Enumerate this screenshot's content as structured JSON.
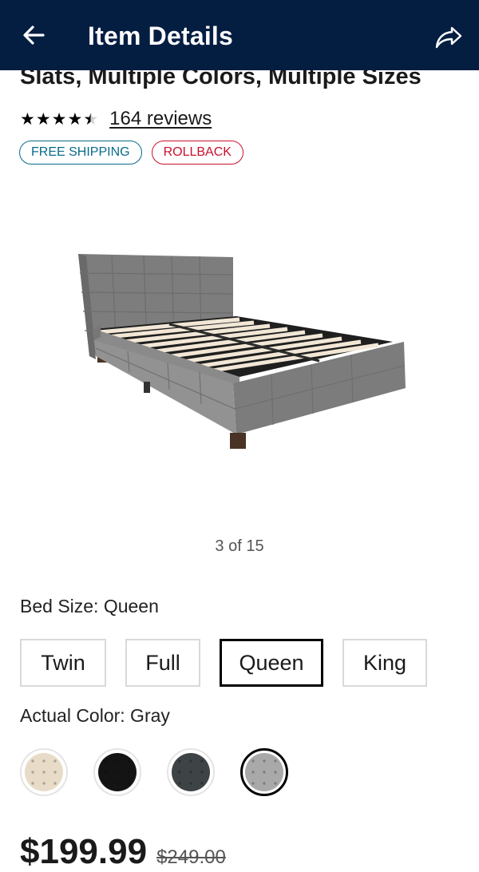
{
  "header": {
    "title": "Item Details",
    "back_icon": "arrow-left-icon",
    "share_icon": "share-icon"
  },
  "product": {
    "title_visible": "Slats, Multiple Colors, Multiple Sizes",
    "rating": 4.5,
    "reviews_text": "164 reviews",
    "badges": [
      "FREE SHIPPING",
      "ROLLBACK"
    ]
  },
  "gallery": {
    "pager_text": "3 of 15"
  },
  "options": {
    "size_label": "Bed Size: Queen",
    "sizes": [
      {
        "label": "Twin",
        "selected": false
      },
      {
        "label": "Full",
        "selected": false
      },
      {
        "label": "Queen",
        "selected": true
      },
      {
        "label": "King",
        "selected": false
      }
    ],
    "color_label": "Actual Color: Gray",
    "colors": [
      {
        "name": "beige",
        "hex": "#e8dcc8",
        "selected": false
      },
      {
        "name": "black",
        "hex": "#141414",
        "selected": false
      },
      {
        "name": "dark gray",
        "hex": "#3e4346",
        "selected": false
      },
      {
        "name": "gray",
        "hex": "#a9a9a9",
        "selected": true
      }
    ]
  },
  "pricing": {
    "price": "$199.99",
    "was_price": "$249.00"
  },
  "colors": {
    "header_bg": "#041e42",
    "shipping_badge": "#0a6b8a",
    "rollback_badge": "#c8102e"
  }
}
